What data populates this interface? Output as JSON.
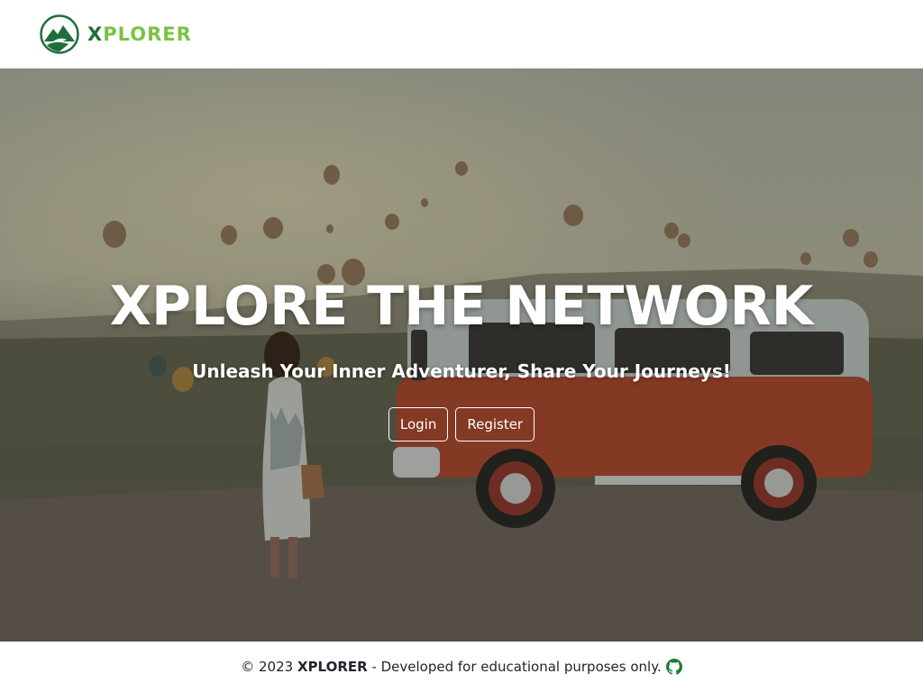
{
  "navbar": {
    "brand": {
      "logo_icon": "mountain-logo-icon",
      "text_first": "X",
      "text_rest": "PLORER",
      "colors": {
        "dark_green": "#1f6f3a",
        "light_green": "#7cc243"
      }
    }
  },
  "hero": {
    "title": "XPLORE THE NETWORK",
    "subtitle": "Unleash Your Inner Adventurer, Share Your Journeys!",
    "buttons": {
      "login_label": "Login",
      "register_label": "Register"
    },
    "background": "hot-air-balloons-van-woman-photo"
  },
  "footer": {
    "copyright": "© 2023",
    "brand": "XPLORER",
    "note": "- Developed for educational purposes only.",
    "github_icon": "github-icon"
  }
}
